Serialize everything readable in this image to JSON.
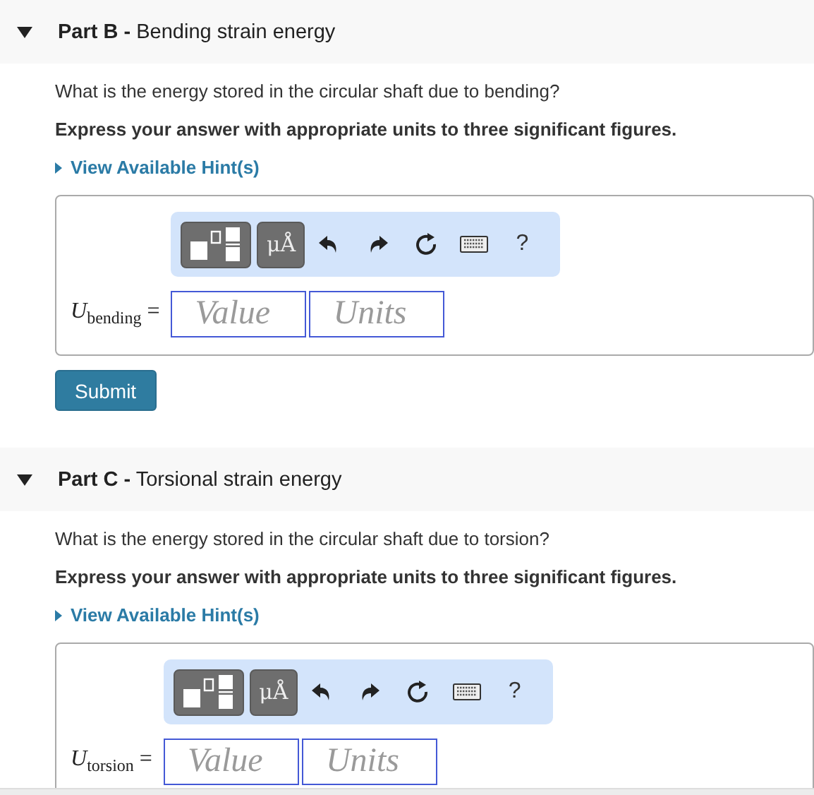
{
  "parts": [
    {
      "label": "Part B -",
      "title": "Bending strain energy",
      "expanded": true,
      "question": "What is the energy stored in the circular shaft due to bending?",
      "instruction": "Express your answer with appropriate units to three significant figures.",
      "hint_link": "View Available Hint(s)",
      "toolbar": {
        "symbols_button": "μÅ",
        "help_button": "?"
      },
      "answer": {
        "variable": "*U*$_{bending}$ =",
        "value_placeholder": "Value",
        "units_placeholder": "Units"
      },
      "submit": "Submit"
    },
    {
      "label": "Part C -",
      "title": "Torsional strain energy",
      "expanded": true,
      "question": "What is the energy stored in the circular shaft due to torsion?",
      "instruction": "Express your answer with appropriate units to three significant figures.",
      "hint_link": "View Available Hint(s)",
      "toolbar": {
        "symbols_button": "μÅ",
        "help_button": "?"
      },
      "answer": {
        "variable": "*U*$_{torsion}$ =",
        "value_placeholder": "Value",
        "units_placeholder": "Units"
      }
    }
  ]
}
